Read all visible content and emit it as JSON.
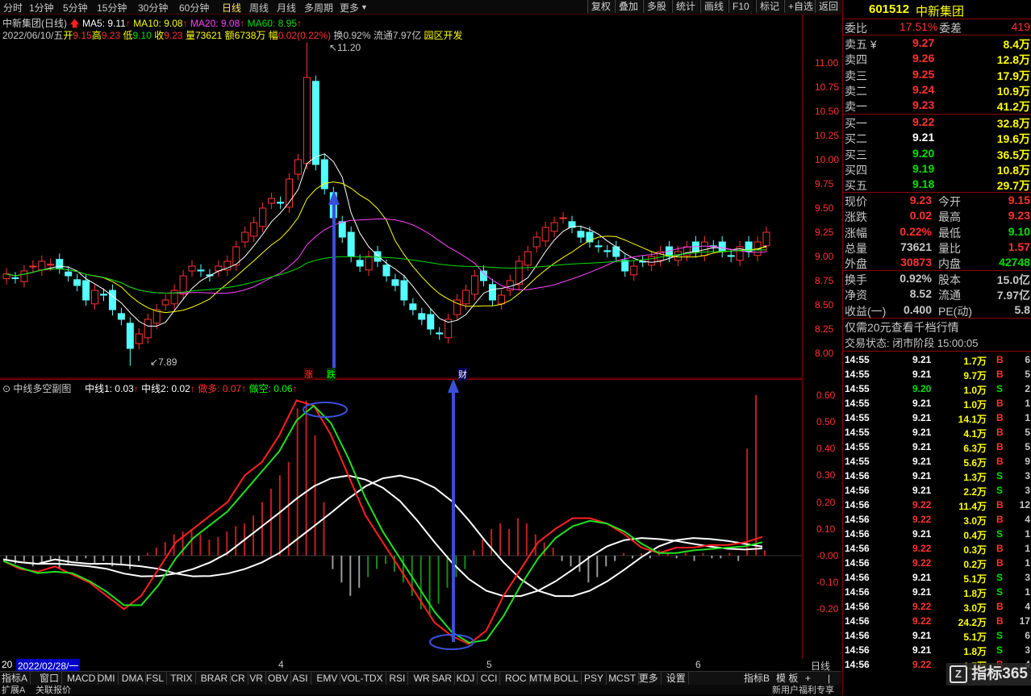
{
  "toolbar": {
    "periods": [
      "分时",
      "1分钟",
      "5分钟",
      "15分钟",
      "30分钟",
      "60分钟",
      "日线",
      "周线",
      "月线",
      "多周期",
      "更多"
    ],
    "actions": [
      "复权",
      "叠加",
      "多股",
      "统计",
      "画线",
      "F10",
      "标记",
      "+自选",
      "返回"
    ]
  },
  "main_info": {
    "title": "中新集团(日线)",
    "ma5": "MA5: 9.11",
    "ma10": "MA10: 9.08",
    "ma20": "MA20: 9.08",
    "ma60": "MA60: 8.95",
    "date": "2022/06/10/五",
    "open_label": "开",
    "open": "9.15",
    "high_label": "高",
    "high": "9.23",
    "low_label": "低",
    "low": "9.10",
    "close_label": "收",
    "close": "9.23",
    "vol_label": "量",
    "vol": "73621",
    "amt_label": "额",
    "amt": "6738万",
    "chg_label": "幅",
    "chg": "0.02(0.22%)",
    "turnover": "换0.92%",
    "float": "流通7.97亿",
    "sector": "园区开发",
    "peak": "11.20",
    "trough": "7.89",
    "mark_zhang": "涨",
    "mark_die": "跌",
    "mark_cai": "财"
  },
  "price_axis": [
    "11.00",
    "10.75",
    "10.50",
    "10.25",
    "10.00",
    "9.75",
    "9.50",
    "9.25",
    "9.00",
    "8.75",
    "8.50",
    "8.25",
    "8.00"
  ],
  "sub_info": {
    "title": "中线多空副图",
    "l1": "中线1: 0.03",
    "l2": "中线2: 0.02",
    "duo": "做多: 0.07",
    "kong": "做空: 0.06"
  },
  "sub_axis": [
    "0.60",
    "0.50",
    "0.40",
    "0.30",
    "0.20",
    "0.10",
    "-0.00",
    "-0.10",
    "-0.20"
  ],
  "date_bar": {
    "start": "2022/02/28/一",
    "m4": "4",
    "m5": "5",
    "m6": "6",
    "prefix": "20",
    "period": "日线"
  },
  "tabs": [
    "指标A",
    "窗口",
    "MACD",
    "DMI",
    "DMA",
    "FSL",
    "TRIX",
    "BRAR",
    "CR",
    "VR",
    "OBV",
    "ASI",
    "EMV",
    "VOL-TDX",
    "RSI",
    "WR",
    "SAR",
    "KDJ",
    "CCI",
    "ROC",
    "MTM",
    "BOLL",
    "PSY",
    "MCST",
    "更多",
    "设置"
  ],
  "tabs_right": [
    "指标B",
    "模 板",
    "+",
    "|"
  ],
  "status": {
    "left1": "扩展A",
    "left2": "关联报价",
    "right": "新用户福利专享"
  },
  "stock": {
    "code": "601512",
    "name": "中新集团"
  },
  "weibi": {
    "label": "委比",
    "value": "17.51%",
    "label2": "委差",
    "value2": "419"
  },
  "asks": [
    {
      "label": "卖五 ¥",
      "price": "9.27",
      "vol": "8.4万"
    },
    {
      "label": "卖四",
      "price": "9.26",
      "vol": "12.8万"
    },
    {
      "label": "卖三",
      "price": "9.25",
      "vol": "17.9万"
    },
    {
      "label": "卖二",
      "price": "9.24",
      "vol": "10.9万"
    },
    {
      "label": "卖一",
      "price": "9.23",
      "vol": "41.2万"
    }
  ],
  "bids": [
    {
      "label": "买一",
      "price": "9.22",
      "vol": "32.8万"
    },
    {
      "label": "买二",
      "price": "9.21",
      "vol": "19.6万"
    },
    {
      "label": "买三",
      "price": "9.20",
      "vol": "36.5万"
    },
    {
      "label": "买四",
      "price": "9.19",
      "vol": "10.8万"
    },
    {
      "label": "买五",
      "price": "9.18",
      "vol": "29.7万"
    }
  ],
  "stats": [
    {
      "l1": "现价",
      "v1": "9.23",
      "l2": "今开",
      "v2": "9.15"
    },
    {
      "l1": "涨跌",
      "v1": "0.02",
      "l2": "最高",
      "v2": "9.23"
    },
    {
      "l1": "涨幅",
      "v1": "0.22%",
      "l2": "最低",
      "v2": "9.10"
    },
    {
      "l1": "总量",
      "v1": "73621",
      "l2": "量比",
      "v2": "1.57"
    },
    {
      "l1": "外盘",
      "v1": "30873",
      "l2": "内盘",
      "v2": "42748"
    }
  ],
  "stats2": [
    {
      "l1": "换手",
      "v1": "0.92%",
      "l2": "股本",
      "v2": "15.0亿"
    },
    {
      "l1": "净资",
      "v1": "8.52",
      "l2": "流通",
      "v2": "7.97亿"
    },
    {
      "l1": "收益(一)",
      "v1": "0.400",
      "l2": "PE(动)",
      "v2": "5.8"
    }
  ],
  "promo": "仅需20元查看千档行情",
  "trade_state": "交易状态: 闭市阶段 15:00:05",
  "trades": [
    {
      "t": "14:55",
      "p": "9.21",
      "v": "1.7万",
      "d": "B",
      "n": "6",
      "pc": "w",
      "dc": "r"
    },
    {
      "t": "14:55",
      "p": "9.21",
      "v": "9.7万",
      "d": "B",
      "n": "5",
      "pc": "w",
      "dc": "r"
    },
    {
      "t": "14:55",
      "p": "9.20",
      "v": "1.0万",
      "d": "S",
      "n": "2",
      "pc": "g",
      "dc": "g"
    },
    {
      "t": "14:55",
      "p": "9.21",
      "v": "1.0万",
      "d": "B",
      "n": "1",
      "pc": "w",
      "dc": "r"
    },
    {
      "t": "14:55",
      "p": "9.21",
      "v": "14.1万",
      "d": "B",
      "n": "1",
      "pc": "w",
      "dc": "r"
    },
    {
      "t": "14:55",
      "p": "9.21",
      "v": "4.1万",
      "d": "B",
      "n": "5",
      "pc": "w",
      "dc": "r"
    },
    {
      "t": "14:55",
      "p": "9.21",
      "v": "6.3万",
      "d": "B",
      "n": "5",
      "pc": "w",
      "dc": "r"
    },
    {
      "t": "14:55",
      "p": "9.21",
      "v": "5.6万",
      "d": "B",
      "n": "9",
      "pc": "w",
      "dc": "r"
    },
    {
      "t": "14:56",
      "p": "9.21",
      "v": "1.3万",
      "d": "S",
      "n": "3",
      "pc": "w",
      "dc": "g"
    },
    {
      "t": "14:56",
      "p": "9.21",
      "v": "2.2万",
      "d": "S",
      "n": "3",
      "pc": "w",
      "dc": "g"
    },
    {
      "t": "14:56",
      "p": "9.22",
      "v": "11.4万",
      "d": "B",
      "n": "12",
      "pc": "r",
      "dc": "r"
    },
    {
      "t": "14:56",
      "p": "9.22",
      "v": "3.0万",
      "d": "B",
      "n": "4",
      "pc": "r",
      "dc": "r"
    },
    {
      "t": "14:56",
      "p": "9.21",
      "v": "0.4万",
      "d": "S",
      "n": "1",
      "pc": "w",
      "dc": "g"
    },
    {
      "t": "14:56",
      "p": "9.22",
      "v": "0.3万",
      "d": "B",
      "n": "1",
      "pc": "r",
      "dc": "r"
    },
    {
      "t": "14:56",
      "p": "9.22",
      "v": "0.2万",
      "d": "B",
      "n": "1",
      "pc": "r",
      "dc": "r"
    },
    {
      "t": "14:56",
      "p": "9.21",
      "v": "5.1万",
      "d": "S",
      "n": "3",
      "pc": "w",
      "dc": "g"
    },
    {
      "t": "14:56",
      "p": "9.21",
      "v": "1.8万",
      "d": "S",
      "n": "1",
      "pc": "w",
      "dc": "g"
    },
    {
      "t": "14:56",
      "p": "9.22",
      "v": "3.0万",
      "d": "B",
      "n": "4",
      "pc": "r",
      "dc": "r"
    },
    {
      "t": "14:56",
      "p": "9.22",
      "v": "24.2万",
      "d": "B",
      "n": "17",
      "pc": "r",
      "dc": "r"
    },
    {
      "t": "14:56",
      "p": "9.21",
      "v": "5.1万",
      "d": "S",
      "n": "6",
      "pc": "w",
      "dc": "g"
    },
    {
      "t": "14:56",
      "p": "9.21",
      "v": "1.8万",
      "d": "S",
      "n": "3",
      "pc": "w",
      "dc": "g"
    },
    {
      "t": "14:56",
      "p": "9.22",
      "v": "1.7万",
      "d": "B",
      "n": "4",
      "pc": "r",
      "dc": "r"
    }
  ],
  "watermark": "指标365",
  "colors": {
    "up": "#ff3232",
    "down": "#54ffff",
    "ma5": "#ffffff",
    "ma10": "#ffff00",
    "ma20": "#ff44ff",
    "ma60": "#00e000",
    "border": "#8b0000",
    "arrow": "#3a4fd8"
  }
}
